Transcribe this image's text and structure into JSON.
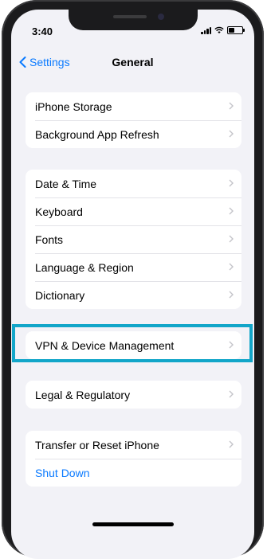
{
  "status_bar": {
    "time": "3:40",
    "battery_level": 0.45
  },
  "navbar": {
    "back_label": "Settings",
    "title": "General"
  },
  "groups": [
    {
      "items": [
        {
          "label": "iPhone Storage"
        },
        {
          "label": "Background App Refresh"
        }
      ]
    },
    {
      "items": [
        {
          "label": "Date & Time"
        },
        {
          "label": "Keyboard"
        },
        {
          "label": "Fonts"
        },
        {
          "label": "Language & Region"
        },
        {
          "label": "Dictionary"
        }
      ]
    },
    {
      "items": [
        {
          "label": "VPN & Device Management"
        }
      ]
    },
    {
      "items": [
        {
          "label": "Legal & Regulatory"
        }
      ]
    },
    {
      "items": [
        {
          "label": "Transfer or Reset iPhone"
        },
        {
          "label": "Shut Down"
        }
      ]
    }
  ],
  "colors": {
    "accent": "#0a7aff",
    "highlight": "#12a6c9",
    "background": "#f2f2f7"
  }
}
